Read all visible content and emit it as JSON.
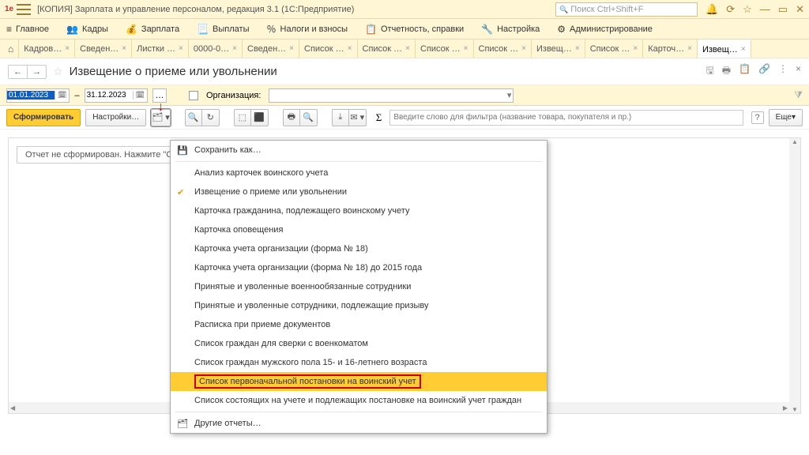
{
  "titlebar": {
    "app_title": "[КОПИЯ] Зарплата и управление персоналом, редакция 3.1  (1С:Предприятие)",
    "search_placeholder": "Поиск Ctrl+Shift+F"
  },
  "mainmenu": [
    {
      "icon": "≡",
      "label": "Главное"
    },
    {
      "icon": "👥",
      "label": "Кадры"
    },
    {
      "icon": "💰",
      "label": "Зарплата"
    },
    {
      "icon": "📃",
      "label": "Выплаты"
    },
    {
      "icon": "％",
      "label": "Налоги и взносы"
    },
    {
      "icon": "📋",
      "label": "Отчетность, справки"
    },
    {
      "icon": "🔧",
      "label": "Настройка"
    },
    {
      "icon": "⚙",
      "label": "Администрирование"
    }
  ],
  "tabs": [
    {
      "label": "Кадров…",
      "close": true
    },
    {
      "label": "Сведен…",
      "close": true
    },
    {
      "label": "Листки …",
      "close": true
    },
    {
      "label": "0000-0…",
      "close": true
    },
    {
      "label": "Сведен…",
      "close": true
    },
    {
      "label": "Список …",
      "close": true
    },
    {
      "label": "Список …",
      "close": true
    },
    {
      "label": "Список …",
      "close": true
    },
    {
      "label": "Список …",
      "close": true
    },
    {
      "label": "Извещ…",
      "close": true
    },
    {
      "label": "Список …",
      "close": true
    },
    {
      "label": "Карточ…",
      "close": true
    },
    {
      "label": "Извещ…",
      "close": true,
      "active": true
    }
  ],
  "form": {
    "title": "Извещение о приеме или увольнении",
    "date_from": "01.01.2023",
    "date_to": "31.12.2023",
    "org_label": "Организация:"
  },
  "toolbar": {
    "generate": "Сформировать",
    "settings": "Настройки…",
    "filter_placeholder": "Введите слово для фильтра (название товара, покупателя и пр.)",
    "more": "Еще"
  },
  "report": {
    "msg_prefix": "Отчет не сформирован. Нажмите \"С"
  },
  "menu": {
    "save_as": "Сохранить как…",
    "items": [
      "Анализ карточек воинского учета",
      "Извещение о приеме или увольнении",
      "Карточка гражданина, подлежащего воинскому учету",
      "Карточка оповещения",
      "Карточка учета организации (форма № 18)",
      "Карточка учета организации (форма № 18) до 2015 года",
      "Принятые и уволенные военнообязанные сотрудники",
      "Принятые и уволенные сотрудники, подлежащие призыву",
      "Расписка при приеме документов",
      "Список граждан для сверки с военкоматом",
      "Список граждан мужского пола 15- и 16-летнего возраста",
      "Список первоначальной постановки на воинский учет",
      "Список состоящих на учете и подлежащих постановке на воинский учет граждан"
    ],
    "other": "Другие отчеты…"
  }
}
